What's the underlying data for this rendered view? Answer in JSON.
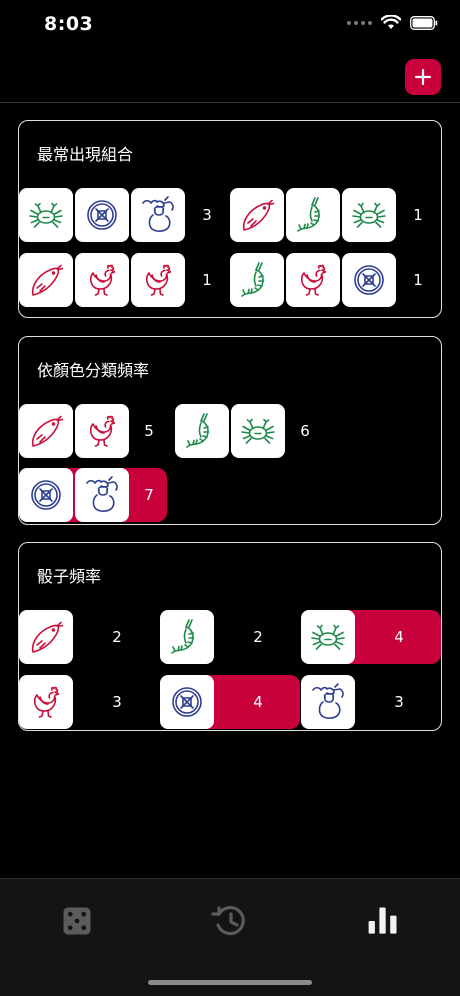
{
  "status": {
    "time": "8:03"
  },
  "colors": {
    "accent": "#c8003c",
    "green": "#1e8a4a",
    "blue": "#2f3f8f",
    "red": "#c8103a"
  },
  "cards": {
    "combos": {
      "title": "最常出現組合"
    },
    "colors": {
      "title": "依顏色分類頻率"
    },
    "dice": {
      "title": "骰子頻率"
    }
  },
  "combos": [
    {
      "icons": [
        "crab-icon",
        "coin-icon",
        "gourd-icon"
      ],
      "count": "3"
    },
    {
      "icons": [
        "fish-icon",
        "prawn-icon",
        "crab-icon"
      ],
      "count": "1"
    },
    {
      "icons": [
        "fish-icon",
        "rooster-icon",
        "rooster-icon"
      ],
      "count": "1"
    },
    {
      "icons": [
        "prawn-icon",
        "rooster-icon",
        "coin-icon"
      ],
      "count": "1"
    }
  ],
  "color_groups": [
    {
      "color": "red",
      "icons": [
        "fish-icon",
        "rooster-icon"
      ],
      "count": "5",
      "highlighted": false
    },
    {
      "color": "green",
      "icons": [
        "prawn-icon",
        "crab-icon"
      ],
      "count": "6",
      "highlighted": false
    },
    {
      "color": "blue",
      "icons": [
        "coin-icon",
        "gourd-icon"
      ],
      "count": "7",
      "highlighted": true
    }
  ],
  "dice_freq": [
    {
      "icon": "fish-icon",
      "count": "2",
      "highlighted": false
    },
    {
      "icon": "prawn-icon",
      "count": "2",
      "highlighted": false
    },
    {
      "icon": "crab-icon",
      "count": "4",
      "highlighted": true
    },
    {
      "icon": "rooster-icon",
      "count": "3",
      "highlighted": false
    },
    {
      "icon": "coin-icon",
      "count": "4",
      "highlighted": true
    },
    {
      "icon": "gourd-icon",
      "count": "3",
      "highlighted": false
    }
  ],
  "tabs": [
    {
      "name": "tab-dice",
      "icon": "dice-icon",
      "active": false
    },
    {
      "name": "tab-history",
      "icon": "history-icon",
      "active": false
    },
    {
      "name": "tab-stats",
      "icon": "bar-chart-icon",
      "active": true
    }
  ]
}
